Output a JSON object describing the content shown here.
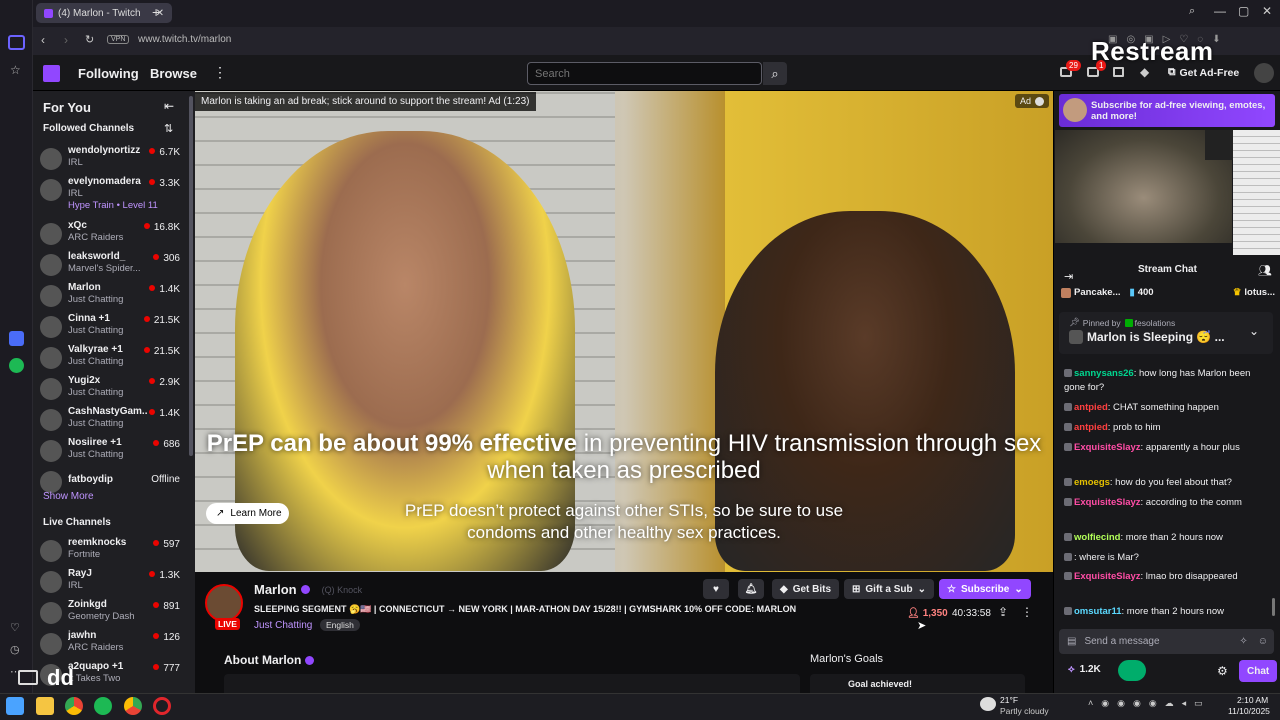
{
  "browser": {
    "tab_title": "(4) Marlon - Twitch",
    "vpn": "VPN",
    "url": "www.twitch.tv/marlon"
  },
  "nav": {
    "following": "Following",
    "browse": "Browse",
    "search_placeholder": "Search",
    "notif_count": "29",
    "inbox_count": "1",
    "get_ad_free": "Get Ad-Free"
  },
  "overlay": {
    "restream": "Restream"
  },
  "sidebar": {
    "for_you": "For You",
    "followed": "Followed Channels",
    "show_more": "Show More",
    "live": "Live Channels",
    "followed_channels": [
      {
        "name": "wendolynortizz",
        "game": "IRL",
        "viewers": "6.7K"
      },
      {
        "name": "evelynomadera",
        "game": "IRL",
        "viewers": "3.3K",
        "extra": "Hype Train • Level 11"
      },
      {
        "name": "xQc",
        "game": "ARC Raiders",
        "viewers": "16.8K"
      },
      {
        "name": "leaksworld_",
        "game": "Marvel's Spider...",
        "viewers": "306"
      },
      {
        "name": "Marlon",
        "game": "Just Chatting",
        "viewers": "1.4K"
      },
      {
        "name": "Cinna +1",
        "game": "Just Chatting",
        "viewers": "21.5K"
      },
      {
        "name": "Valkyrae +1",
        "game": "Just Chatting",
        "viewers": "21.5K"
      },
      {
        "name": "Yugi2x",
        "game": "Just Chatting",
        "viewers": "2.9K"
      },
      {
        "name": "CashNastyGam...",
        "game": "Just Chatting",
        "viewers": "1.4K"
      },
      {
        "name": "Nosiiree +1",
        "game": "Just Chatting",
        "viewers": "686"
      },
      {
        "name": "fatboydip",
        "game": "",
        "viewers": "Offline"
      }
    ],
    "live_channels": [
      {
        "name": "reemknocks",
        "game": "Fortnite",
        "viewers": "597"
      },
      {
        "name": "RayJ",
        "game": "IRL",
        "viewers": "1.3K"
      },
      {
        "name": "Zoinkgd",
        "game": "Geometry Dash",
        "viewers": "891"
      },
      {
        "name": "jawhn",
        "game": "ARC Raiders",
        "viewers": "126"
      },
      {
        "name": "a2quapo +1",
        "game": "It Takes Two",
        "viewers": "777"
      }
    ]
  },
  "video": {
    "ad_notice": "Marlon is taking an ad break; stick around to support the stream! Ad (1:23)",
    "ad_tag": "Ad",
    "headline_bold": "PrEP can be about 99% effective",
    "headline_rest": " in preventing HIV transmission through sex when taken as prescribed",
    "subline": "PrEP doesn’t protect against other STIs, so be sure to use condoms and other healthy sex practices.",
    "learn_more": "Learn More"
  },
  "stream": {
    "channel": "Marlon",
    "badge": "(Q) Knock",
    "live": "LIVE",
    "title": "SLEEPING SEGMENT 🥱🇺🇸 | CONNECTICUT → NEW YORK | MAR-ATHON DAY 15/28!! | GYMSHARK 10% OFF CODE: MARLON",
    "category": "Just Chatting",
    "language": "English",
    "get_bits": "Get Bits",
    "gift_sub": "Gift a Sub",
    "subscribe": "Subscribe",
    "viewers": "1,350",
    "uptime": "40:33:58",
    "about": "About Marlon",
    "goals": "Marlon's Goals",
    "goal_achieved": "Goal achieved!"
  },
  "chat": {
    "promo": "Subscribe for ad-free viewing, emotes, and more!",
    "header": "Stream Chat",
    "leader1": "Pancake...",
    "leader1_count": "400",
    "leader2": "lotus...",
    "pinned_by": "Pinned by",
    "pinned_user": "fesolations",
    "pinned_msg": "Marlon is Sleeping 😴 ...",
    "messages": [
      {
        "user": "sannysans26",
        "text": ": how long has Marlon been gone for?",
        "color": "#00d68f"
      },
      {
        "user": "antpied",
        "text": ": CHAT something happen",
        "color": "#ff4040"
      },
      {
        "user": "antpied",
        "text": ": prob to him",
        "color": "#ff4040"
      },
      {
        "user": "ExquisiteSlayz",
        "text": ": apparently a hour plus",
        "color": "#ff4da6"
      },
      {
        "user": "emoegs",
        "text": ": how do you feel about that?",
        "color": "#e5c100"
      },
      {
        "user": "ExquisiteSlayz",
        "text": ": according to the comm",
        "color": "#ff4da6"
      },
      {
        "user": "wolfiecind",
        "text": ": more than 2 hours now",
        "color": "#b2ff59"
      },
      {
        "user": "",
        "text": ": where is Mar?",
        "color": "#5c5cff"
      },
      {
        "user": "ExquisiteSlayz",
        "text": ": lmao bro disappeared",
        "color": "#ff4da6"
      },
      {
        "user": "omsutar11",
        "text": ": more than 2 hours now",
        "color": "#5bd9ff"
      }
    ],
    "send_placeholder": "Send a message",
    "points": "1.2K",
    "chat_btn": "Chat"
  },
  "taskbar": {
    "weather_temp": "21°F",
    "weather_desc": "Partly cloudy",
    "time": "2:10 AM",
    "date": "11/10/2025",
    "overlay_text": "dd"
  },
  "colors": {
    "twitch_purple": "#9147ff",
    "live_red": "#eb0400",
    "bg": "#0e0e10"
  }
}
